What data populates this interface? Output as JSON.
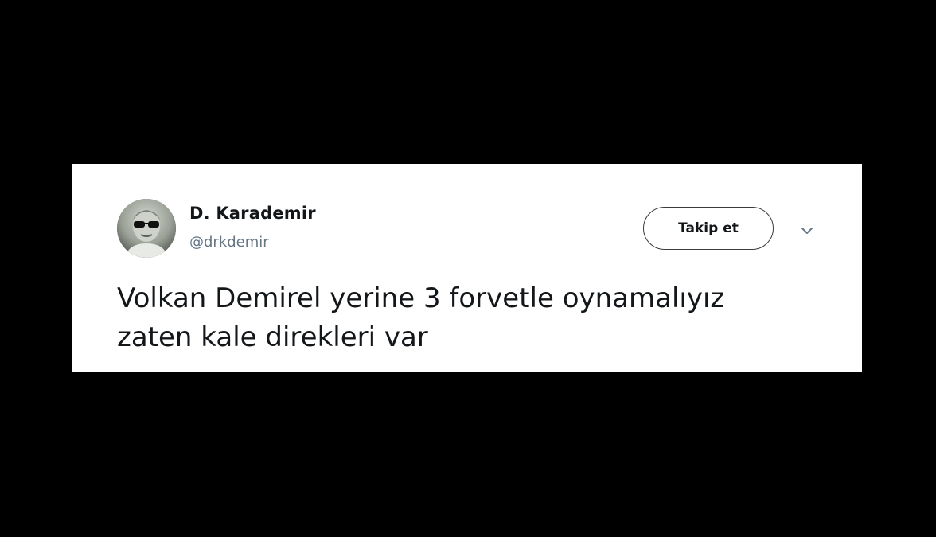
{
  "tweet": {
    "author": {
      "display_name": "D. Karademir",
      "handle": "@drkdemir",
      "avatar_icon": "profile-photo"
    },
    "follow_button_label": "Takip et",
    "menu_icon": "chevron-down-icon",
    "text_lines": [
      "Volkan Demirel yerine 3 forvetle oynamalıyız",
      "zaten kale direkleri var"
    ]
  },
  "colors": {
    "background": "#000000",
    "card": "#ffffff",
    "text": "#14171a",
    "secondary_text": "#657786"
  }
}
